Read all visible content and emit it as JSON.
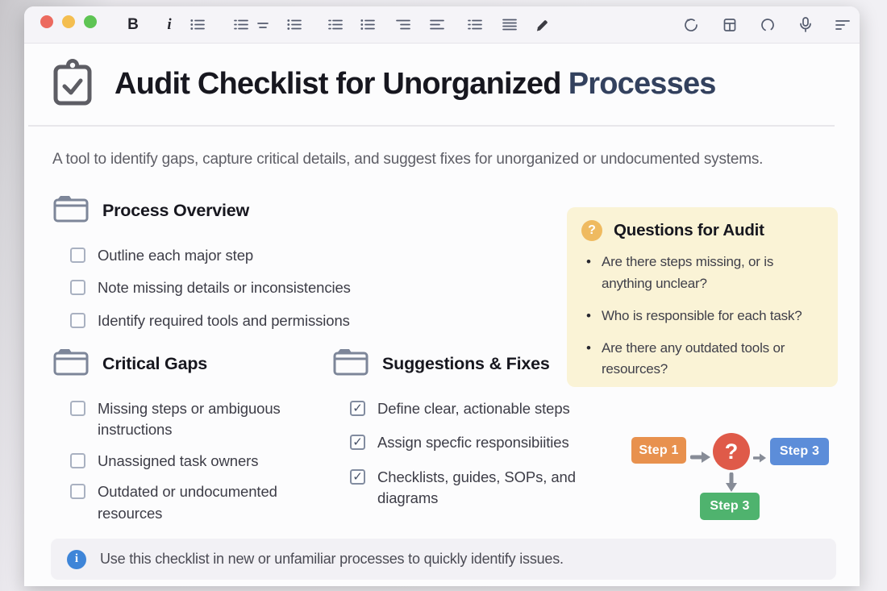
{
  "toolbar": {
    "bold": "B",
    "italic": "i"
  },
  "title": {
    "main": "Audit Checklist for Unorganized",
    "accent": "Processes"
  },
  "subtitle": "A tool to identify gaps, capture critical details, and suggest fixes for unorganized or undocumented systems.",
  "sections": {
    "process_overview": {
      "heading": "Process Overview",
      "items": [
        {
          "label": "Outline each major step",
          "mark": ""
        },
        {
          "label": "Note missing details or inconsistencies",
          "mark": ""
        },
        {
          "label": "Identify required tools and permissions",
          "mark": ""
        }
      ]
    },
    "critical_gaps": {
      "heading": "Critical Gaps",
      "items": [
        {
          "label": "Missing steps or ambiguous instructions",
          "mark": ""
        },
        {
          "label": "Unassigned task owners",
          "mark": ""
        },
        {
          "label": "Outdated or undocumented resources",
          "mark": ""
        }
      ]
    },
    "suggestions": {
      "heading": "Suggestions & Fixes",
      "items": [
        {
          "label": "Define clear, actionable steps",
          "mark": "✓"
        },
        {
          "label": "Assign specfic responsibiities",
          "mark": "✓"
        },
        {
          "label": "Checklists, guides, SOPs, and diagrams",
          "mark": "✓"
        }
      ]
    },
    "questions": {
      "heading": "Questions for Audit",
      "badge": "?",
      "bullet": "•",
      "items": [
        "Are there steps missing, or is anything unclear?",
        "Who is responsible for each task?",
        "Are there any outdated tools or resources?"
      ]
    }
  },
  "diagram": {
    "step1": "Step 1",
    "question_mark": "?",
    "step3_top": "Step 3",
    "step3_bottom": "Step 3"
  },
  "info_bar": {
    "badge": "i",
    "text": "Use this checklist in new or unfamiliar processes to quickly identify issues."
  },
  "colors": {
    "step1_orange": "#E8914E",
    "question_red": "#DF5A49",
    "step3_blue": "#5C8DD9",
    "step3_green": "#4FB36E",
    "questions_bg": "#FAF3D6",
    "badge_orange": "#EFBA60",
    "info_blue": "#3E85D8"
  }
}
